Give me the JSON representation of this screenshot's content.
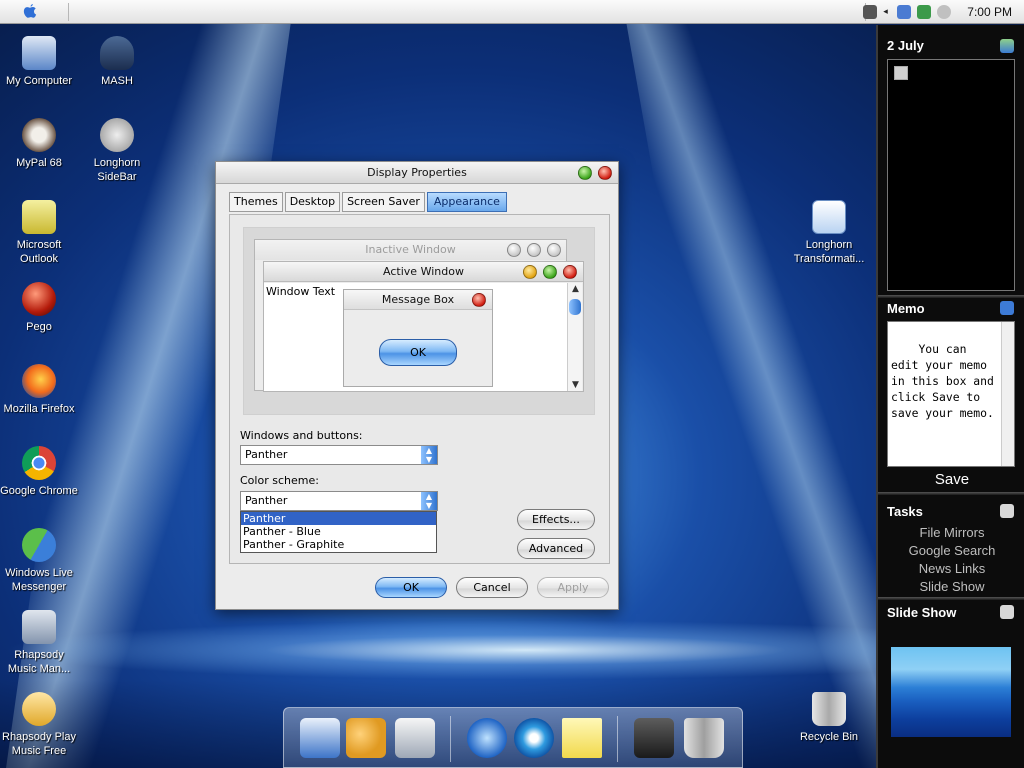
{
  "menubar": {
    "clock": "7:00 PM"
  },
  "desktop_icons": [
    {
      "label": "My Computer",
      "icon": "computer-icon"
    },
    {
      "label": "MASH",
      "icon": "mash-icon"
    },
    {
      "label": "MyPal 68",
      "icon": "mypal-icon"
    },
    {
      "label": "Longhorn SideBar",
      "icon": "sidebar-icon"
    },
    {
      "label": "Microsoft Outlook",
      "icon": "outlook-icon"
    },
    {
      "label": "Pego",
      "icon": "pego-icon"
    },
    {
      "label": "Mozilla Firefox",
      "icon": "firefox-icon"
    },
    {
      "label": "Google Chrome",
      "icon": "chrome-icon"
    },
    {
      "label": "Windows Live Messenger",
      "icon": "messenger-icon"
    },
    {
      "label": "Rhapsody Music Man...",
      "icon": "rhapsody-manager-icon"
    },
    {
      "label": "Rhapsody Play Music Free",
      "icon": "rhapsody-play-icon"
    },
    {
      "label": "Longhorn Transformati...",
      "icon": "notepad-icon"
    },
    {
      "label": "Recycle Bin",
      "icon": "recycle-bin-icon"
    }
  ],
  "dialog": {
    "title": "Display Properties",
    "tabs": [
      "Themes",
      "Desktop",
      "Screen Saver",
      "Appearance"
    ],
    "active_tab": "Appearance",
    "preview": {
      "inactive_title": "Inactive Window",
      "active_title": "Active Window",
      "window_text": "Window Text",
      "message_title": "Message Box",
      "message_ok": "OK"
    },
    "windows_buttons_label": "Windows and buttons:",
    "windows_buttons_value": "Panther",
    "color_scheme_label": "Color scheme:",
    "color_scheme_value": "Panther",
    "color_scheme_options": [
      "Panther",
      "Panther - Blue",
      "Panther - Graphite"
    ],
    "effects_label": "Effects...",
    "advanced_label": "Advanced",
    "ok_label": "OK",
    "cancel_label": "Cancel",
    "apply_label": "Apply"
  },
  "sidebar": {
    "date": "2 July",
    "memo_title": "Memo",
    "memo_text": "You can edit your memo in this box and click Save to save your memo.",
    "save_label": "Save",
    "tasks_title": "Tasks",
    "tasks": [
      "File Mirrors",
      "Google Search",
      "News Links",
      "Slide Show"
    ],
    "slideshow_title": "Slide Show"
  },
  "dock": [
    "computer-icon",
    "users-icon",
    "scanner-icon",
    "internet-explorer-icon",
    "media-player-icon",
    "notes-icon",
    "settings-icon",
    "trash-icon"
  ],
  "colors": {
    "accent": "#3163c6",
    "aqua_button": "#4d93e6",
    "sidebar_bg": "#0c0c0c"
  }
}
